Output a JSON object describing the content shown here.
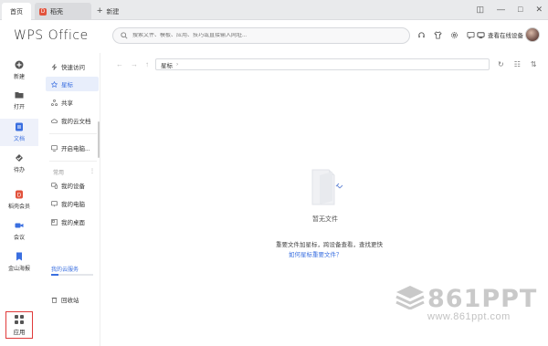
{
  "tabs": {
    "home_label": "首页",
    "docer_label": "稻壳",
    "docer_logo": "D",
    "new_label": "新建"
  },
  "window_controls": {
    "restore": "◫",
    "minimize": "—",
    "maximize": "□",
    "close": "✕"
  },
  "header": {
    "brand": "WPS Office",
    "search_placeholder": "搜索文件、模板、应用、技巧或直接输入网址...",
    "device_label": "查看在线设备"
  },
  "leftnav": [
    {
      "label": "新建",
      "icon": "plus-circle-icon",
      "color": "#555555"
    },
    {
      "label": "打开",
      "icon": "folder-icon",
      "color": "#555555"
    },
    {
      "label": "文档",
      "icon": "document-icon",
      "color": "#3a6fe0",
      "active": true
    },
    {
      "label": "待办",
      "icon": "check-icon",
      "color": "#555555"
    },
    {
      "label": "稻壳会员",
      "icon": "docer-icon",
      "color": "#e2523c"
    },
    {
      "label": "会议",
      "icon": "meeting-icon",
      "color": "#3a6fe0"
    },
    {
      "label": "金山海报",
      "icon": "poster-icon",
      "color": "#3a6fe0"
    }
  ],
  "apps_label": "应用",
  "subnav": {
    "quick_access": "快速访问",
    "starred": "星标",
    "shared": "共享",
    "my_cloud": "我的云文档",
    "open_computer": "开启电脑...",
    "common_header": "常用",
    "common_more": "⋮",
    "my_devices": "我的设备",
    "my_computer": "我的电脑",
    "my_desktop": "我的桌面",
    "recycle_bin": "回收站",
    "cloud_service": "我的云服务"
  },
  "toolbar": {
    "back": "←",
    "forward": "→",
    "up": "↑",
    "breadcrumb": "星标",
    "breadcrumb_sep": "›",
    "refresh": "↻",
    "view": "☷",
    "sort": "⇅"
  },
  "empty_state": {
    "title": "暂无文件",
    "hint": "重要文件加星标，跨设备查看，查找更快",
    "link": "如何星标重要文件？"
  },
  "watermark": {
    "logo": "861PPT",
    "url": "www.861ppt.com"
  },
  "colors": {
    "accent": "#3a6fe0",
    "highlight_box": "#e03a3a"
  }
}
